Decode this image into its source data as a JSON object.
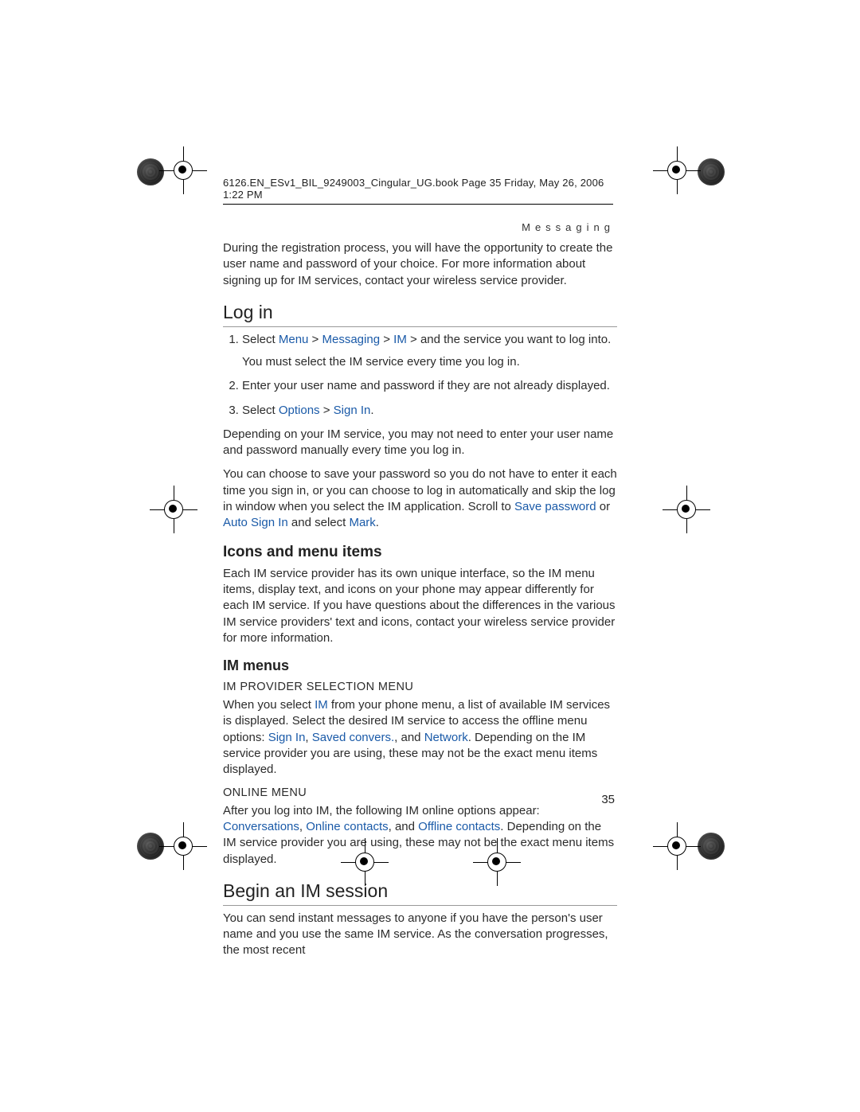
{
  "header": {
    "crop_line": "6126.EN_ESv1_BIL_9249003_Cingular_UG.book  Page 35  Friday, May 26, 2006  1:22 PM",
    "running_head": "Messaging"
  },
  "body": {
    "intro": "During the registration process, you will have the opportunity to create the user name and password of your choice. For more information about signing up for IM services, contact your wireless service provider.",
    "login": {
      "title": "Log in",
      "step1_prefix": "Select ",
      "menu": "Menu",
      "gt1": " > ",
      "messaging": "Messaging",
      "gt2": " > ",
      "im": "IM",
      "gt3": " > ",
      "step1_suffix": "and the service you want to log into.",
      "step1_note": "You must select the IM service every time you log in.",
      "step2": "Enter your user name and password if they are not already displayed.",
      "step3_prefix": "Select ",
      "options": "Options",
      "gt4": " > ",
      "signin": "Sign In",
      "step3_suffix": ".",
      "after_a": "Depending on your IM service, you may not need to enter your user name and password manually every time you log in.",
      "after_b_1": "You can choose to save your password so you do not have to enter it each time you sign in, or you can choose to log in automatically and skip the log in window when you select the IM application. Scroll to ",
      "save_password": "Save password",
      "after_b_2": " or ",
      "auto_sign_in": "Auto Sign In",
      "after_b_3": " and select ",
      "mark": "Mark",
      "after_b_4": "."
    },
    "icons": {
      "title": "Icons and menu items",
      "p": "Each IM service provider has its own unique interface, so the IM menu items, display text, and icons on your phone may appear differently for each IM service. If you have questions about the differences in the various IM service providers' text and icons, contact your wireless service provider for more information."
    },
    "menus": {
      "title": "IM menus",
      "prov_title": "IM PROVIDER SELECTION MENU",
      "prov_1": "When you select ",
      "prov_im": "IM",
      "prov_2": " from your phone menu, a list of available IM services is displayed. Select the desired IM service to access the offline menu options: ",
      "prov_signin": "Sign In",
      "prov_sep1": ", ",
      "prov_saved": "Saved convers.",
      "prov_sep2": ", and ",
      "prov_network": "Network",
      "prov_3": ". Depending on the IM service provider you are using, these may not be the exact menu items displayed.",
      "online_title": "ONLINE MENU",
      "online_1": "After you log into IM, the following IM online options appear: ",
      "online_conv": "Conversations",
      "online_sep1": ", ",
      "online_online": "Online contacts",
      "online_sep2": ", and ",
      "online_offline": "Offline contacts",
      "online_2": ". Depending on the IM service provider you are using, these may not be the exact menu items displayed."
    },
    "session": {
      "title": "Begin an IM session",
      "p": "You can send instant messages to anyone if you have the person's user name and you use the same IM service. As the conversation progresses, the most recent"
    }
  },
  "page_number": "35"
}
